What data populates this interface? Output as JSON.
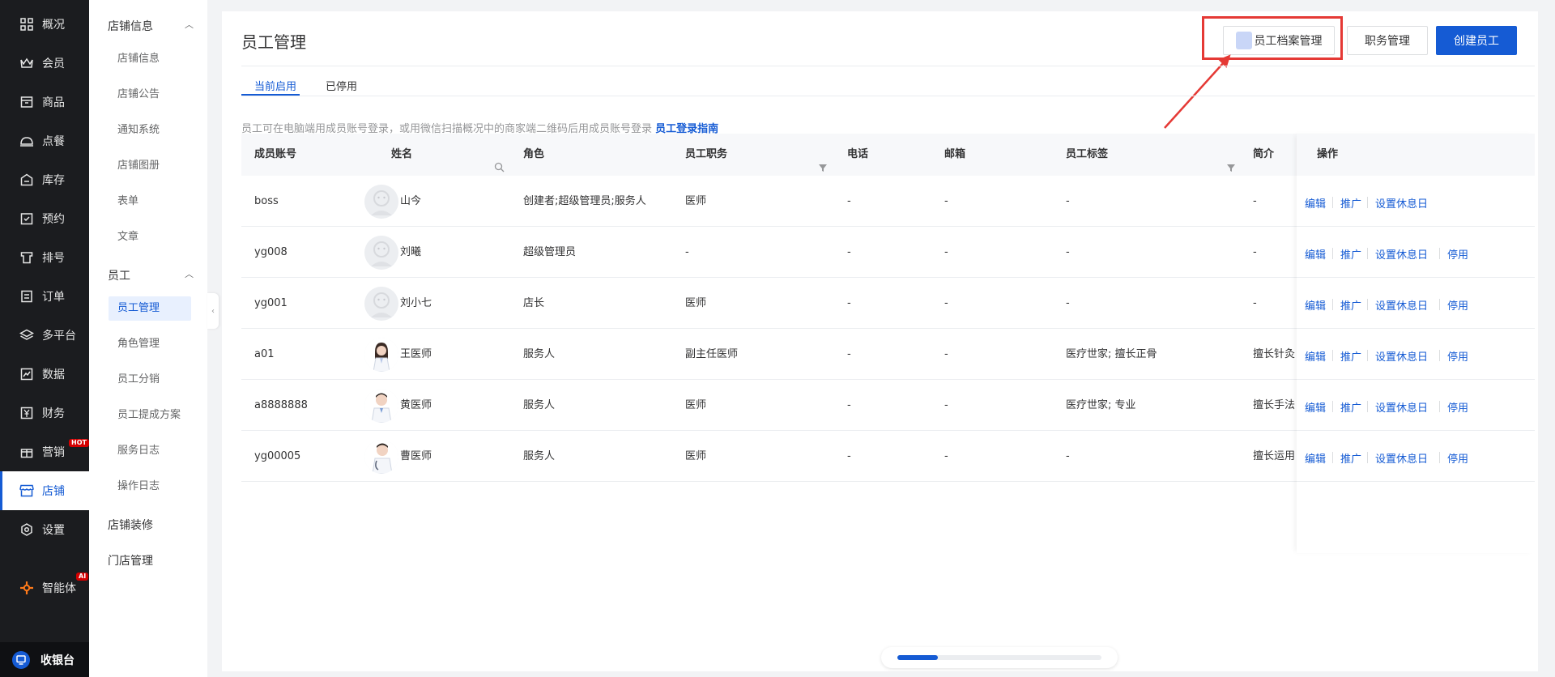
{
  "leftnav": {
    "items": [
      {
        "label": "概况",
        "icon": "grid-icon"
      },
      {
        "label": "会员",
        "icon": "crown-icon"
      },
      {
        "label": "商品",
        "icon": "box-icon"
      },
      {
        "label": "点餐",
        "icon": "dining-bell-icon"
      },
      {
        "label": "库存",
        "icon": "warehouse-icon"
      },
      {
        "label": "预约",
        "icon": "calendar-check-icon"
      },
      {
        "label": "排号",
        "icon": "queue-ticket-icon"
      },
      {
        "label": "订单",
        "icon": "order-list-icon"
      },
      {
        "label": "多平台",
        "icon": "layers-icon"
      },
      {
        "label": "数据",
        "icon": "chart-icon"
      },
      {
        "label": "财务",
        "icon": "yuan-icon"
      },
      {
        "label": "营销",
        "icon": "gift-icon",
        "badge": "HOT"
      },
      {
        "label": "店铺",
        "icon": "store-icon",
        "active": true
      },
      {
        "label": "设置",
        "icon": "gear-icon"
      },
      {
        "label": "智能体",
        "icon": "sparkle-icon",
        "badge": "AI"
      }
    ],
    "cashier": "收银台"
  },
  "subnav": {
    "group1": "店铺信息",
    "group1_items": [
      "店铺信息",
      "店铺公告",
      "通知系统",
      "店铺图册",
      "表单",
      "文章"
    ],
    "group2": "员工",
    "group2_items": [
      "员工管理",
      "角色管理",
      "员工分销",
      "员工提成方案",
      "服务日志",
      "操作日志"
    ],
    "group3": "店铺装修",
    "group4": "门店管理"
  },
  "page": {
    "title": "员工管理",
    "btn_archive": "员工档案管理",
    "btn_duty": "职务管理",
    "btn_create": "创建员工",
    "tabs": [
      "当前启用",
      "已停用"
    ],
    "notice": "员工可在电脑端用成员账号登录，或用微信扫描概况中的商家端二维码后用成员账号登录",
    "notice_link": "员工登录指南"
  },
  "table": {
    "headers": {
      "account": "成员账号",
      "name": "姓名",
      "role": "角色",
      "duty": "员工职务",
      "phone": "电话",
      "email": "邮箱",
      "tags": "员工标签",
      "intro": "简介",
      "ops": "操作"
    },
    "ops_labels": {
      "edit": "编辑",
      "promote": "推广",
      "rest": "设置休息日",
      "disable": "停用"
    },
    "rows": [
      {
        "account": "boss",
        "name": "山今",
        "role": "创建者;超级管理员;服务人",
        "duty": "医师",
        "phone": "-",
        "email": "-",
        "tags": "-",
        "intro": "-",
        "avatar": "default",
        "can_disable": false
      },
      {
        "account": "yg008",
        "name": "刘曦",
        "role": "超级管理员",
        "duty": "-",
        "phone": "-",
        "email": "-",
        "tags": "-",
        "intro": "-",
        "avatar": "default",
        "can_disable": true
      },
      {
        "account": "yg001",
        "name": "刘小七",
        "role": "店长",
        "duty": "医师",
        "phone": "-",
        "email": "-",
        "tags": "-",
        "intro": "-",
        "avatar": "default",
        "can_disable": true
      },
      {
        "account": "a01",
        "name": "王医师",
        "role": "服务人",
        "duty": "副主任医师",
        "phone": "-",
        "email": "-",
        "tags": "医疗世家; 擅长正骨",
        "intro": "擅长针灸",
        "avatar": "doctor-female",
        "can_disable": true
      },
      {
        "account": "a8888888",
        "name": "黄医师",
        "role": "服务人",
        "duty": "医师",
        "phone": "-",
        "email": "-",
        "tags": "医疗世家; 专业",
        "intro": "擅长手法",
        "avatar": "doctor-male",
        "can_disable": true
      },
      {
        "account": "yg00005",
        "name": "曹医师",
        "role": "服务人",
        "duty": "医师",
        "phone": "-",
        "email": "-",
        "tags": "-",
        "intro": "擅长运用",
        "avatar": "doctor-male2",
        "can_disable": true
      }
    ]
  },
  "scroll": {
    "position_fraction": 0.0,
    "visible_fraction": 0.2
  },
  "colors": {
    "accent": "#155bd4",
    "highlight": "#e53935",
    "nav_bg": "#1b1c1f"
  }
}
